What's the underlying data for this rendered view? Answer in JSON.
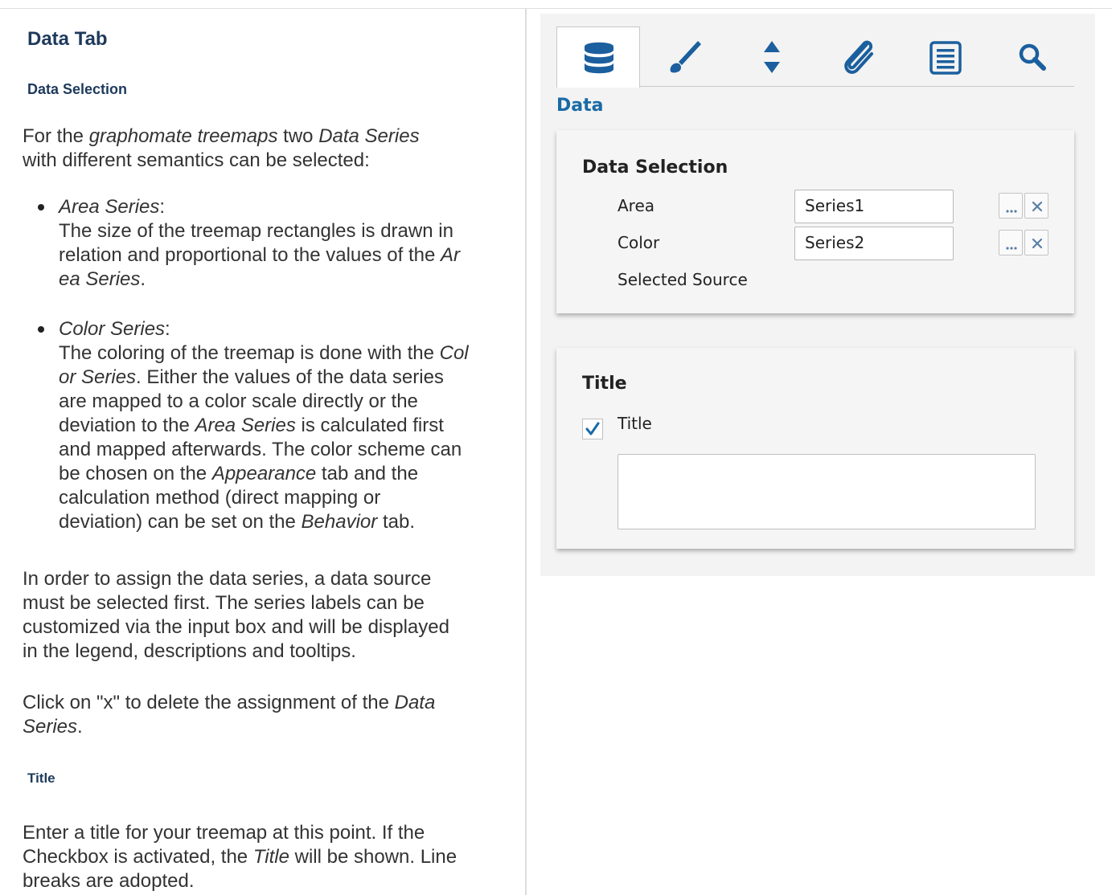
{
  "doc": {
    "heading": "Data Tab",
    "data_selection_heading": "Data Selection",
    "p1": [
      {
        "t": "For the "
      },
      {
        "t": "graphomate treemaps",
        "i": true
      },
      {
        "t": " two "
      },
      {
        "t": "Data Series",
        "i": true
      },
      {
        "t": "\nwith different semantics can be selected:"
      }
    ],
    "bullets": [
      [
        {
          "t": "Area Series",
          "i": true
        },
        {
          "t": ":\nThe size of the treemap rectangles is drawn in\nrelation and proportional to the values of the "
        },
        {
          "t": "Ar\nea Series",
          "i": true
        },
        {
          "t": "."
        }
      ],
      [
        {
          "t": "Color Series",
          "i": true
        },
        {
          "t": ":\nThe coloring of the treemap is done with the "
        },
        {
          "t": "Col\nor Series",
          "i": true
        },
        {
          "t": ". Either the values of the data series\nare mapped to a color scale directly or the\ndeviation to the "
        },
        {
          "t": "Area Series",
          "i": true
        },
        {
          "t": " is calculated first\nand mapped afterwards. The color scheme can\nbe chosen on the "
        },
        {
          "t": "Appearance",
          "i": true
        },
        {
          "t": " tab and the\ncalculation method (direct mapping or\ndeviation) can be set on the "
        },
        {
          "t": "Behavior",
          "i": true
        },
        {
          "t": " tab."
        }
      ]
    ],
    "p2": [
      {
        "t": "In order to assign the data series, a data source\nmust be selected first. The series labels can be\ncustomized via the input box and will be displayed\nin the legend, descriptions and tooltips."
      }
    ],
    "p3": [
      {
        "t": "Click on \"x\" to delete the assignment of the "
      },
      {
        "t": "Data\nSeries",
        "i": true
      },
      {
        "t": "."
      }
    ],
    "title_heading": "Title",
    "p4": [
      {
        "t": "Enter a title for your treemap at this point. If the\nCheckbox is activated, the "
      },
      {
        "t": "Title",
        "i": true
      },
      {
        "t": " will be shown. Line\nbreaks are adopted."
      }
    ]
  },
  "panel": {
    "tabs": [
      {
        "icon": "database-icon",
        "active": true
      },
      {
        "icon": "brush-icon",
        "active": false
      },
      {
        "icon": "sort-arrows-icon",
        "active": false
      },
      {
        "icon": "paperclip-icon",
        "active": false
      },
      {
        "icon": "list-icon",
        "active": false
      },
      {
        "icon": "search-icon",
        "active": false
      }
    ],
    "section_heading": "Data",
    "data_selection": {
      "title": "Data Selection",
      "area_label": "Area",
      "area_value": "Series1",
      "color_label": "Color",
      "color_value": "Series2",
      "selected_source_label": "Selected Source"
    },
    "title_section": {
      "title": "Title",
      "checkbox_label": "Title",
      "checkbox_checked": true,
      "title_text": ""
    },
    "colors": {
      "accent": "#1a6aa6",
      "icon": "#1b5f9e",
      "heading": "#1e3a5c"
    }
  }
}
